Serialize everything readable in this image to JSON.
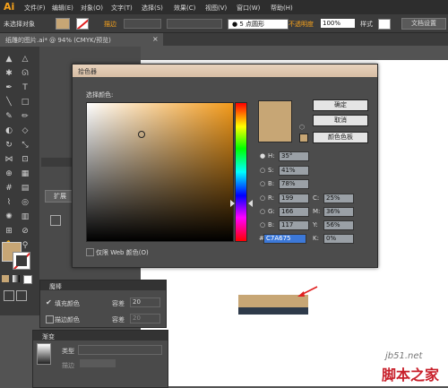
{
  "app": {
    "logo": "Ai"
  },
  "menu": [
    "文件(F)",
    "编辑(E)",
    "对象(O)",
    "文字(T)",
    "选择(S)",
    "效果(C)",
    "视图(V)",
    "窗口(W)",
    "帮助(H)"
  ],
  "control_bar": {
    "no_selection": "未选择对象",
    "stroke_label": "描边",
    "brush_label": "5 点圆形",
    "opacity_label": "不透明度",
    "opacity_value": "100%",
    "style_label": "样式",
    "doc_settings": "文档设置"
  },
  "document_tab": {
    "title": "纸雕的图片.ai* @ 94% (CMYK/预览)",
    "close": "×"
  },
  "colors": {
    "fill": "#c7a675",
    "dark_rect": "#2e3a4a",
    "accent": "#f7a21b",
    "hex_highlight": "#3c78d8"
  },
  "color_picker": {
    "title": "拾色器",
    "select_label": "选择颜色:",
    "ok": "确定",
    "cancel": "取消",
    "swatches": "颜色色板",
    "web_only": "仅限 Web 颜色(O)",
    "H": {
      "label": "H:",
      "value": "35°"
    },
    "S": {
      "label": "S:",
      "value": "41%"
    },
    "B": {
      "label": "B:",
      "value": "78%"
    },
    "R": {
      "label": "R:",
      "value": "199"
    },
    "G": {
      "label": "G:",
      "value": "166"
    },
    "Bl": {
      "label": "B:",
      "value": "117"
    },
    "C": {
      "label": "C:",
      "value": "25%"
    },
    "M": {
      "label": "M:",
      "value": "36%"
    },
    "Y": {
      "label": "Y:",
      "value": "56%"
    },
    "K": {
      "label": "K:",
      "value": "0%"
    },
    "hex_label": "#",
    "hex_value": "C7A675"
  },
  "left_panel": {
    "expand": "扩展"
  },
  "magic_wand": {
    "title": "魔棒",
    "fill_color": "填充颜色",
    "stroke_color": "描边颜色",
    "tolerance_label": "容差",
    "tolerance_value": "20",
    "stroke_tolerance": "20"
  },
  "gradient": {
    "title": "渐变",
    "type_label": "类型",
    "stroke_label": "描边"
  },
  "watermark": {
    "site": "jb51.net",
    "name": "脚本之家"
  }
}
